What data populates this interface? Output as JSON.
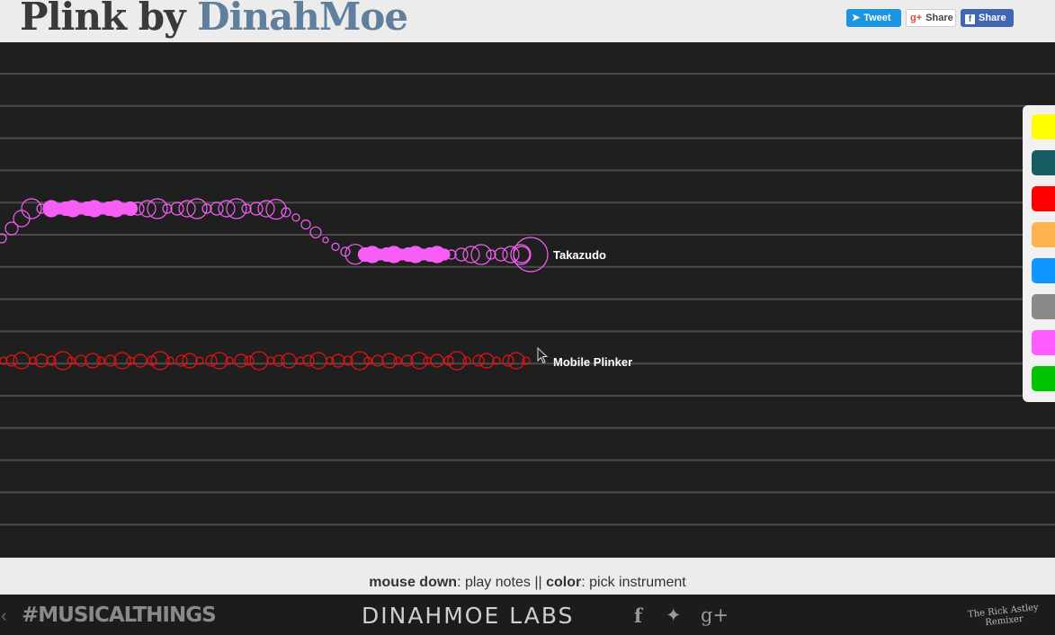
{
  "header": {
    "title_prefix": "Plink by ",
    "title_brand": "DinahMoe",
    "share": {
      "tweet": "Tweet",
      "google": "Share",
      "facebook": "Share"
    }
  },
  "players": [
    {
      "name": "Takazudo",
      "color": "#f65ef6"
    },
    {
      "name": "Mobile Plinker",
      "color": "#ee1111"
    }
  ],
  "palette": {
    "colors": [
      "#ffff00",
      "#175b63",
      "#ff0000",
      "#ffb24e",
      "#0f97ff",
      "#8a8a8a",
      "#ff5cff",
      "#00c400"
    ]
  },
  "instructions": {
    "mouse_key": "mouse down",
    "mouse_desc": ": play notes || ",
    "color_key": "color",
    "color_desc": ": pick instrument"
  },
  "footer": {
    "hashtag": "#MUSICALTHINGS",
    "brand": "DINAHMOE LABS",
    "rick": "The Rick Astley Remixer",
    "icons": [
      "prev-arrow-icon",
      "facebook-icon",
      "twitter-icon",
      "google-plus-icon"
    ]
  }
}
